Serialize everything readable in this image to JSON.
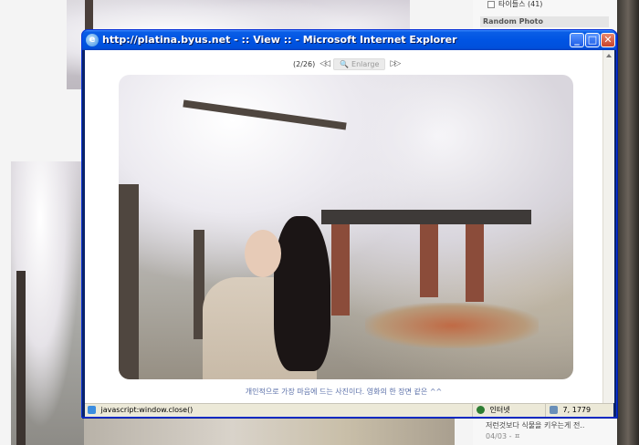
{
  "background": {
    "sidebar_item": "타이들스 (41)",
    "sidebar_heading": "Random Photo",
    "news_text": "저런것보다 식물을 키우는게 전..",
    "news_date": "04/03 - ㅍ"
  },
  "window": {
    "title": "http://platina.byus.net - :: View :: - Microsoft Internet Explorer",
    "min_glyph": "_",
    "max_glyph": "□",
    "close_glyph": "✕"
  },
  "viewer": {
    "counter": "(2/26)",
    "prev_glyph": "◁◁",
    "next_glyph": "▷▷",
    "enlarge_label": "Enlarge",
    "caption": "개인적으로 가장 마음에 드는 사진이다. 영화의 한 장면 같은 ^^"
  },
  "statusbar": {
    "status_text": "javascript:window.close()",
    "zone": "인터넷",
    "counter": "7, 1779"
  }
}
